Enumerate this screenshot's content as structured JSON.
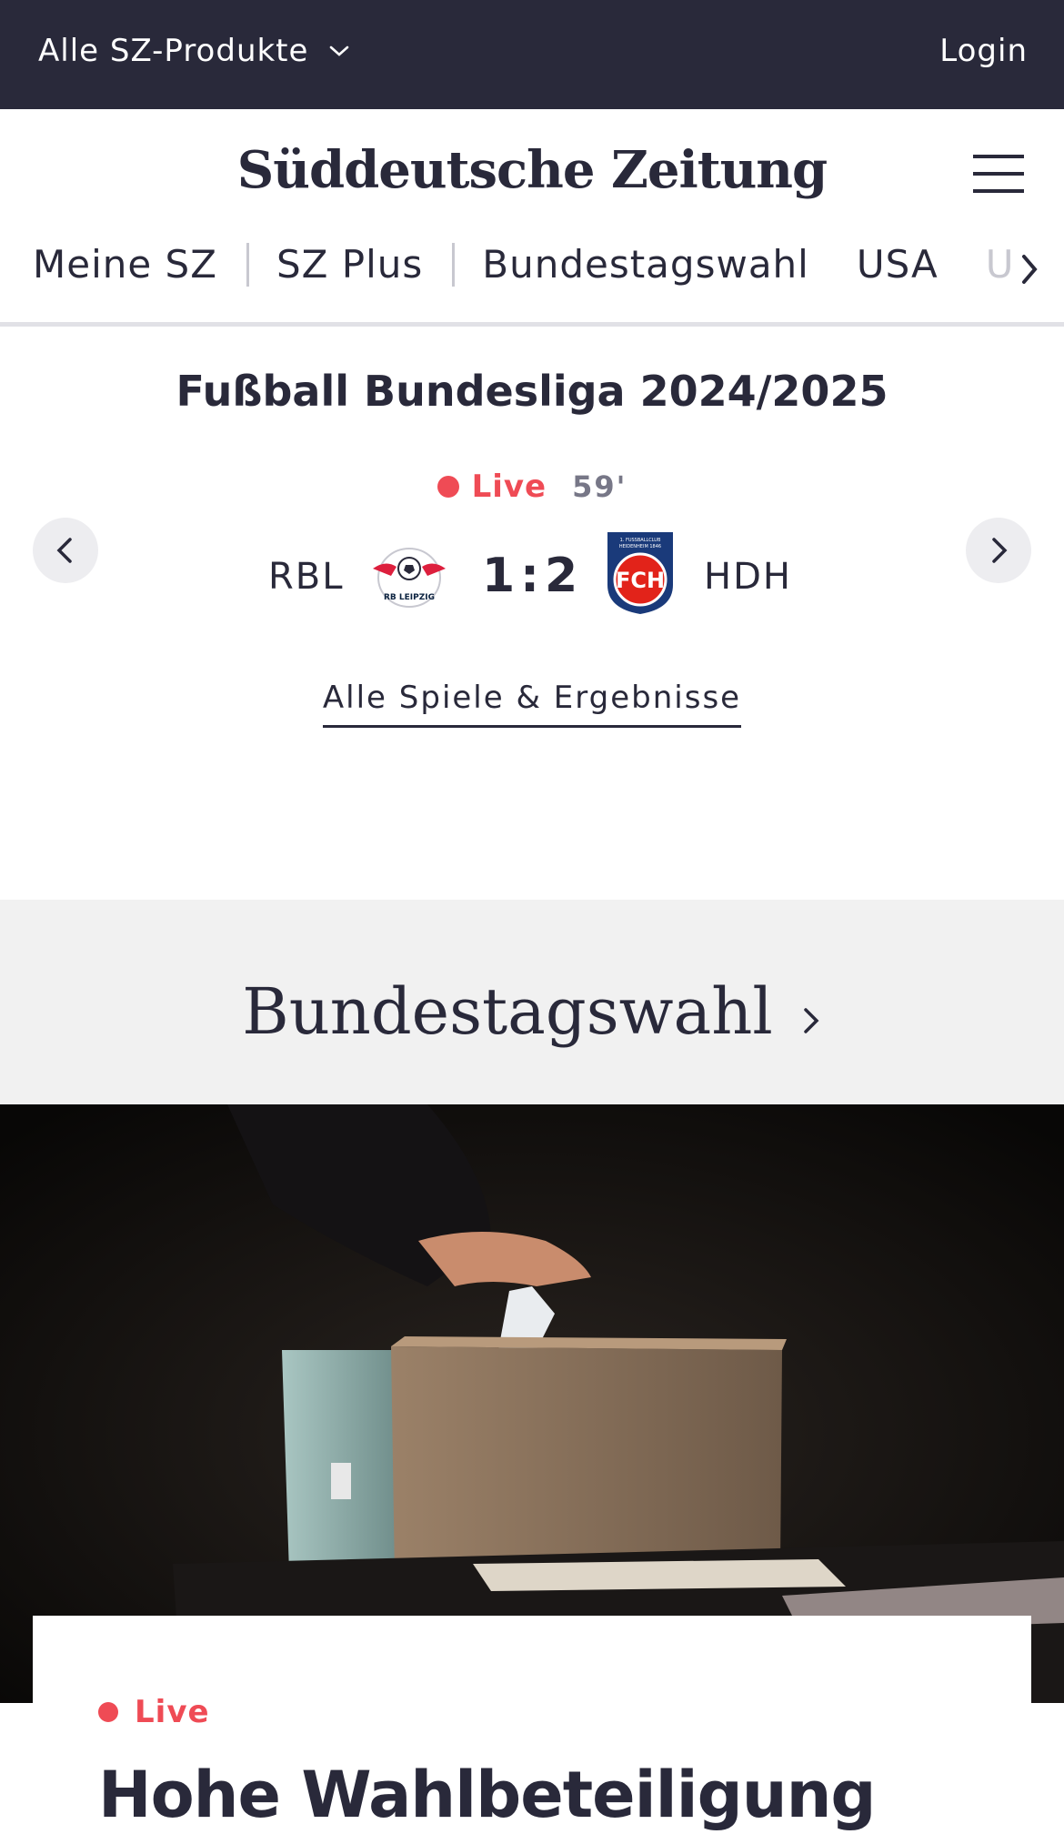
{
  "topbar": {
    "products_label": "Alle SZ-Produkte",
    "login_label": "Login"
  },
  "header": {
    "logo": "Süddeutsche Zeitung"
  },
  "nav": {
    "items": [
      "Meine SZ",
      "SZ Plus",
      "Bundestagswahl",
      "USA",
      "U"
    ]
  },
  "widget": {
    "title": "Fußball Bundesliga 2024/2025",
    "status": "Live",
    "minute": "59'",
    "home_team": "RBL",
    "away_team": "HDH",
    "score": "1:2",
    "all_games_link": "Alle Spiele & Ergebnisse",
    "home_crest_text": "RB LEIPZIG",
    "away_crest_text": "FCH",
    "away_crest_top_text": "1. FUSSBALLCLUB HEIDENHEIM 1846"
  },
  "section": {
    "title": "Bundestagswahl"
  },
  "article": {
    "status": "Live",
    "headline": "Hohe Wahlbeteiligung"
  },
  "colors": {
    "dark": "#29293a",
    "live_red": "#ef4b55",
    "section_bg": "#f1f1f1"
  }
}
